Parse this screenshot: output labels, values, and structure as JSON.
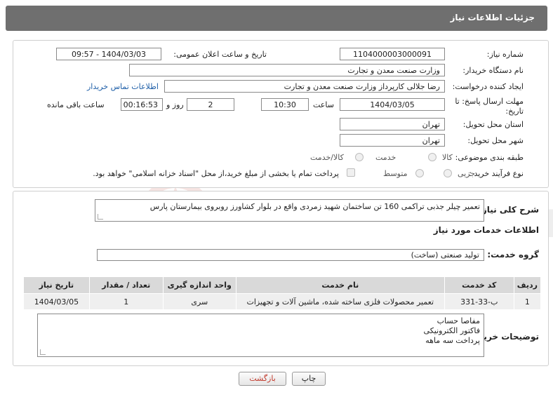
{
  "header": {
    "title": "جزئیات اطلاعات نیاز"
  },
  "form": {
    "need_number_label": "شماره نیاز:",
    "need_number": "1104000003000091",
    "announce_label": "تاریخ و ساعت اعلان عمومی:",
    "announce_value": "1404/03/03 - 09:57",
    "buyer_org_label": "نام دستگاه خریدار:",
    "buyer_org": "وزارت صنعت معدن و تجارت",
    "creator_label": "ایجاد کننده درخواست:",
    "creator": "رضا جلالی کارپرداز وزارت صنعت معدن و تجارت",
    "contact_link": "اطلاعات تماس خریدار",
    "deadline_label": "مهلت ارسال پاسخ: تا تاریخ:",
    "deadline_date": "1404/03/05",
    "time_label": "ساعت",
    "deadline_time": "10:30",
    "days_value": "2",
    "days_label": "روز و",
    "remaining_time": "00:16:53",
    "remaining_label": "ساعت باقی مانده",
    "province_label": "استان محل تحویل:",
    "province": "تهران",
    "city_label": "شهر محل تحویل:",
    "city": "تهران",
    "category_label": "طبقه بندی موضوعی:",
    "category_options": [
      "کالا",
      "خدمت",
      "کالا/خدمت"
    ],
    "process_label": "نوع فرآیند خرید :",
    "process_options": [
      "جزیی",
      "متوسط"
    ],
    "payment_note": "پرداخت تمام یا بخشی از مبلغ خرید،از محل \"اسناد خزانه اسلامی\" خواهد بود."
  },
  "description": {
    "label": "شرح کلی نیاز:",
    "text": "تعمیر چیلر جذبی تراکمی 160 تن ساختمان شهید زمردی واقع در بلوار کشاورز روبروی بیمارستان پارس"
  },
  "services": {
    "section_title": "اطلاعات خدمات مورد نیاز",
    "group_label": "گروه خدمت:",
    "group_value": "تولید صنعتی (ساخت)",
    "columns": [
      "ردیف",
      "کد خدمت",
      "نام خدمت",
      "واحد اندازه گیری",
      "تعداد / مقدار",
      "تاریخ نیاز"
    ],
    "rows": [
      [
        "1",
        "ب-33-331",
        "تعمیر محصولات فلزی ساخته شده، ماشین آلات و تجهیزات",
        "سری",
        "1",
        "1404/03/05"
      ]
    ]
  },
  "buyer_notes": {
    "label": "توضیحات خریدار:",
    "lines": [
      "مفاصا حساب",
      "فاکتور الکترونیکی",
      "پرداخت سه ماهه"
    ]
  },
  "buttons": {
    "print": "چاپ",
    "back": "بازگشت"
  },
  "watermark": {
    "text": "AriaTender.net"
  },
  "colors": {
    "header_bg": "#6f6f6f",
    "link": "#1f5fa8",
    "table_header": "#d9d9d9",
    "back_button_text": "#c0392b"
  }
}
